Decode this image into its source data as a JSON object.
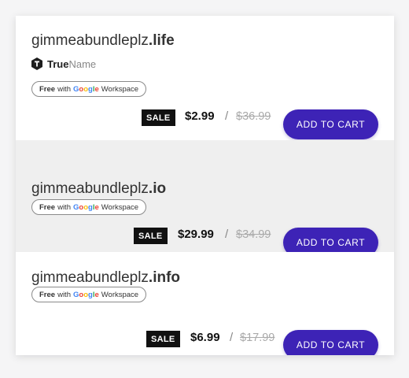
{
  "listings": [
    {
      "domain_name": "gimmeabundleplz",
      "domain_tld": ".life",
      "registrar": {
        "strong": "True",
        "light": "Name"
      },
      "badge": {
        "free": "Free",
        "with": "with",
        "google": [
          "G",
          "o",
          "o",
          "g",
          "l",
          "e"
        ],
        "product": "Workspace"
      },
      "sale_label": "SALE",
      "price": "$2.99",
      "slash": "/",
      "old_price": "$36.99",
      "cta": "ADD TO CART"
    },
    {
      "domain_name": "gimmeabundleplz",
      "domain_tld": ".io",
      "badge": {
        "free": "Free",
        "with": "with",
        "google": [
          "G",
          "o",
          "o",
          "g",
          "l",
          "e"
        ],
        "product": "Workspace"
      },
      "sale_label": "SALE",
      "price": "$29.99",
      "slash": "/",
      "old_price": "$34.99",
      "cta": "ADD TO CART"
    },
    {
      "domain_name": "gimmeabundleplz",
      "domain_tld": ".info",
      "badge": {
        "free": "Free",
        "with": "with",
        "google": [
          "G",
          "o",
          "o",
          "g",
          "l",
          "e"
        ],
        "product": "Workspace"
      },
      "sale_label": "SALE",
      "price": "$6.99",
      "slash": "/",
      "old_price": "$17.99",
      "cta": "ADD TO CART"
    }
  ],
  "colors": {
    "cta": "#3d23b6",
    "sale_bg": "#111111",
    "alt_row": "#efefef",
    "old_price": "#aaaaaa"
  },
  "icons": {
    "registrar_logo": "truename-logo-icon"
  }
}
